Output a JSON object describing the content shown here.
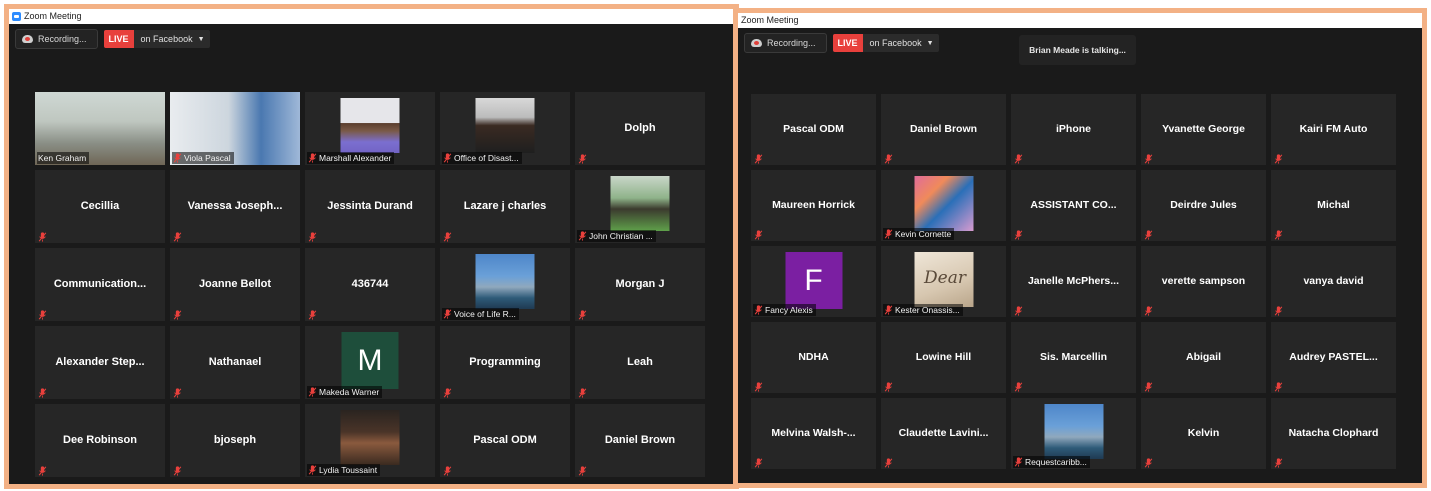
{
  "window_left": {
    "title": "Zoom Meeting",
    "recording_label": "Recording...",
    "live_label": "LIVE",
    "stream_label": "on Facebook",
    "tiles": [
      {
        "name": "Ken Graham",
        "kind": "video",
        "active": true
      },
      {
        "name": "Viola Pascal",
        "kind": "video"
      },
      {
        "name": "Marshall Alexander",
        "kind": "photo"
      },
      {
        "name": "Office of Disast...",
        "kind": "photo"
      },
      {
        "name": "Dolph",
        "kind": "name"
      },
      {
        "name": "Cecillia",
        "kind": "name"
      },
      {
        "name": "Vanessa  Joseph...",
        "kind": "name"
      },
      {
        "name": "Jessinta Durand",
        "kind": "name"
      },
      {
        "name": "Lazare j charles",
        "kind": "name"
      },
      {
        "name": "John Christian ...",
        "kind": "photo"
      },
      {
        "name": "Communication...",
        "kind": "name"
      },
      {
        "name": "Joanne Bellot",
        "kind": "name"
      },
      {
        "name": "436744",
        "kind": "name"
      },
      {
        "name": "Voice of Life R...",
        "kind": "photo"
      },
      {
        "name": "Morgan J",
        "kind": "name"
      },
      {
        "name": "Alexander  Step...",
        "kind": "name"
      },
      {
        "name": "Nathanael",
        "kind": "name"
      },
      {
        "name": "Makeda Warner",
        "kind": "letter",
        "letter": "M",
        "color": "#1e4e3b"
      },
      {
        "name": "Programming",
        "kind": "name"
      },
      {
        "name": "Leah",
        "kind": "name"
      },
      {
        "name": "Dee Robinson",
        "kind": "name"
      },
      {
        "name": "bjoseph",
        "kind": "name"
      },
      {
        "name": "Lydia Toussaint",
        "kind": "photo"
      },
      {
        "name": "Pascal ODM",
        "kind": "name"
      },
      {
        "name": "Daniel Brown",
        "kind": "name"
      }
    ]
  },
  "window_right": {
    "title": "Zoom Meeting",
    "recording_label": "Recording...",
    "live_label": "LIVE",
    "stream_label": "on Facebook",
    "talking_banner": "Brian Meade is talking...",
    "tiles": [
      {
        "name": "Pascal ODM",
        "kind": "name"
      },
      {
        "name": "Daniel Brown",
        "kind": "name"
      },
      {
        "name": "iPhone",
        "kind": "name"
      },
      {
        "name": "Yvanette George",
        "kind": "name"
      },
      {
        "name": "Kairi FM Auto",
        "kind": "name"
      },
      {
        "name": "Maureen Horrick",
        "kind": "name"
      },
      {
        "name": "Kevin Cornette",
        "kind": "photo"
      },
      {
        "name": "ASSISTANT  CO...",
        "kind": "name"
      },
      {
        "name": "Deirdre Jules",
        "kind": "name"
      },
      {
        "name": "Michal",
        "kind": "name"
      },
      {
        "name": "Fancy Alexis",
        "kind": "letter",
        "letter": "F",
        "color": "#7b1fa2"
      },
      {
        "name": "Kester Onassis...",
        "kind": "photo",
        "overlay_text": "Dear"
      },
      {
        "name": "Janelle  McPhers...",
        "kind": "name"
      },
      {
        "name": "verette sampson",
        "kind": "name"
      },
      {
        "name": "vanya david",
        "kind": "name"
      },
      {
        "name": "NDHA",
        "kind": "name"
      },
      {
        "name": "Lowine Hill",
        "kind": "name"
      },
      {
        "name": "Sis. Marcellin",
        "kind": "name"
      },
      {
        "name": "Abigail",
        "kind": "name"
      },
      {
        "name": "Audrey  PASTEL...",
        "kind": "name"
      },
      {
        "name": "Melvina  Walsh-...",
        "kind": "name"
      },
      {
        "name": "Claudette  Lavini...",
        "kind": "name"
      },
      {
        "name": "Requestcaribb...",
        "kind": "photo"
      },
      {
        "name": "Kelvin",
        "kind": "name"
      },
      {
        "name": "Natacha Clophard",
        "kind": "name"
      }
    ]
  },
  "colors": {
    "frame_border": "#f3b185",
    "background": "#1a1a1a",
    "tile": "#262626",
    "live": "#e8403c",
    "active_speaker": "#cfe27a",
    "muted_icon": "#e8403c"
  },
  "icons": {
    "app": "zoom-icon",
    "recording": "recording-cloud-icon",
    "dropdown": "chevron-down-icon",
    "muted": "muted-mic-icon"
  }
}
